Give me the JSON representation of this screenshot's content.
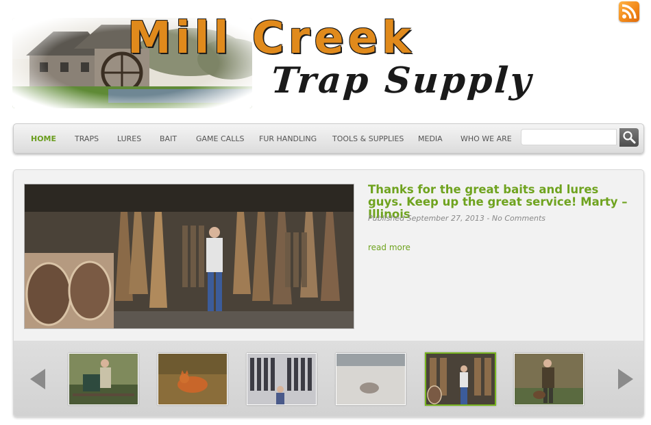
{
  "site": {
    "title_line1": "Mill Creek",
    "title_line2": "Trap Supply"
  },
  "rss": {
    "icon": "rss-icon"
  },
  "nav": {
    "items": [
      {
        "label": "HOME",
        "active": true
      },
      {
        "label": "TRAPS"
      },
      {
        "label": "LURES"
      },
      {
        "label": "BAIT"
      },
      {
        "label": "GAME CALLS"
      },
      {
        "label": "FUR HANDLING"
      },
      {
        "label": "TOOLS & SUPPLIES"
      },
      {
        "label": "MEDIA"
      },
      {
        "label": "WHO WE ARE"
      }
    ],
    "search": {
      "value": "",
      "placeholder": "",
      "icon": "search-icon"
    }
  },
  "featured": {
    "title": "Thanks for the great baits and lures guys. Keep up the great service! Marty – Illinois",
    "meta_published": "Published September 27, 2013 -",
    "meta_comments": "No Comments",
    "read_more": "read more"
  },
  "slider": {
    "prev_icon": "arrow-left-icon",
    "next_icon": "arrow-right-icon",
    "active_index": 4,
    "thumbnails": [
      "thumbnail-1",
      "thumbnail-2",
      "thumbnail-3",
      "thumbnail-4",
      "thumbnail-5",
      "thumbnail-6"
    ]
  },
  "colors": {
    "accent_green": "#6fa31f",
    "logo_orange": "#e08a1c",
    "nav_text": "#555555"
  }
}
